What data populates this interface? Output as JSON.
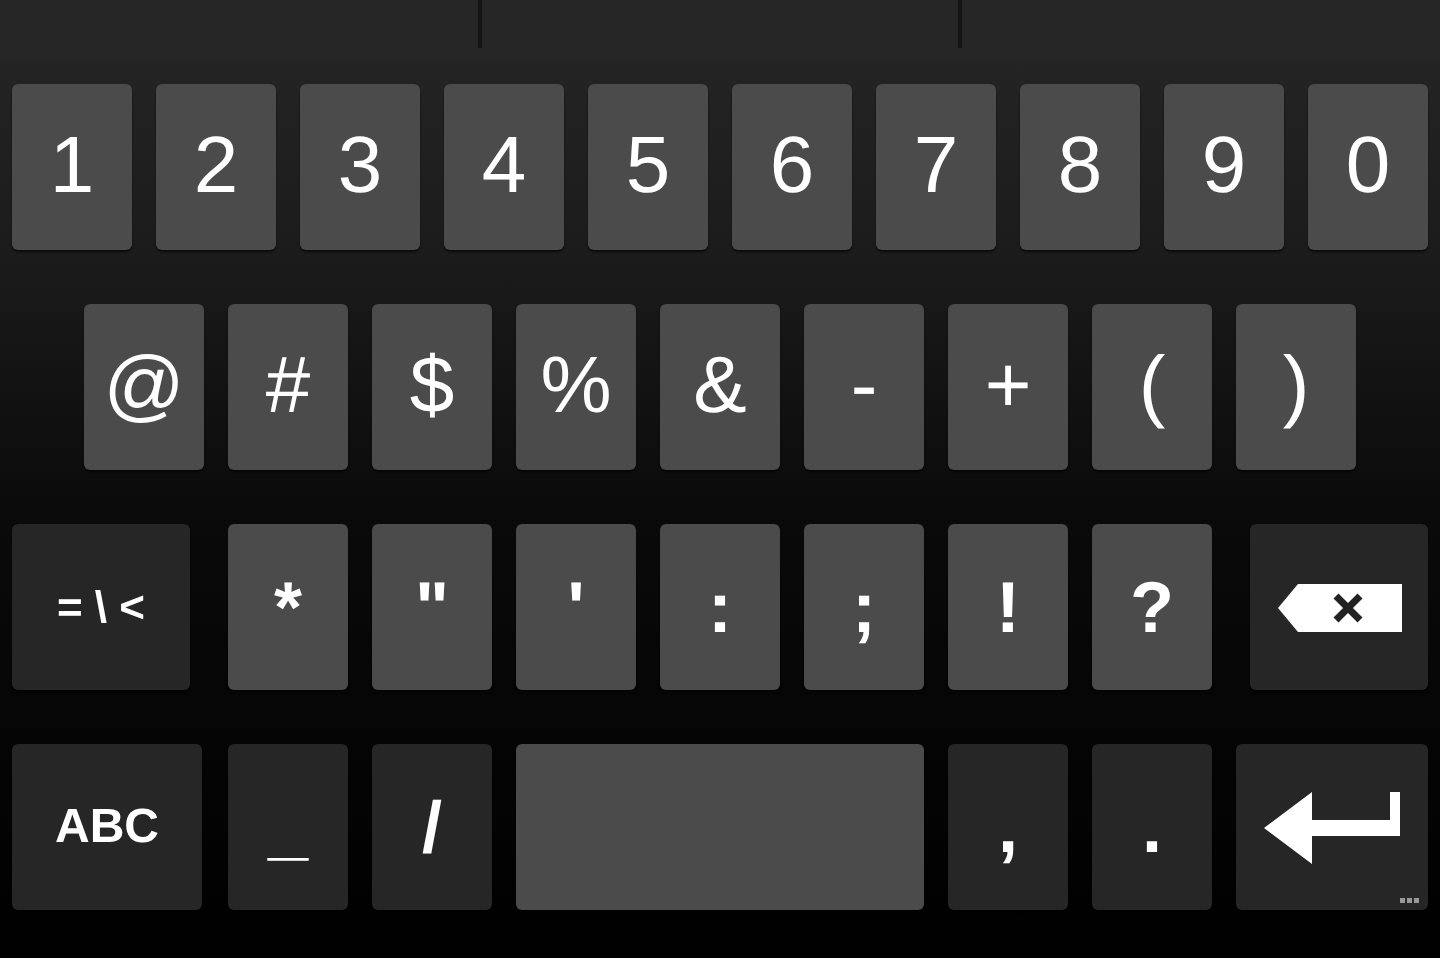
{
  "rows": [
    [
      {
        "kind": "char",
        "label": "1"
      },
      {
        "kind": "char",
        "label": "2"
      },
      {
        "kind": "char",
        "label": "3"
      },
      {
        "kind": "char",
        "label": "4"
      },
      {
        "kind": "char",
        "label": "5"
      },
      {
        "kind": "char",
        "label": "6"
      },
      {
        "kind": "char",
        "label": "7"
      },
      {
        "kind": "char",
        "label": "8"
      },
      {
        "kind": "char",
        "label": "9"
      },
      {
        "kind": "char",
        "label": "0"
      }
    ],
    [
      {
        "kind": "char",
        "label": "@"
      },
      {
        "kind": "char",
        "label": "#"
      },
      {
        "kind": "char",
        "label": "$"
      },
      {
        "kind": "char",
        "label": "%"
      },
      {
        "kind": "char",
        "label": "&"
      },
      {
        "kind": "char",
        "label": "-"
      },
      {
        "kind": "char",
        "label": "+"
      },
      {
        "kind": "char",
        "label": "("
      },
      {
        "kind": "char",
        "label": ")"
      }
    ],
    [
      {
        "kind": "mode",
        "label": "= \\ <"
      },
      {
        "kind": "char",
        "label": "*"
      },
      {
        "kind": "char",
        "label": "\""
      },
      {
        "kind": "char",
        "label": "'"
      },
      {
        "kind": "char",
        "label": ":"
      },
      {
        "kind": "char",
        "label": ";"
      },
      {
        "kind": "char",
        "label": "!"
      },
      {
        "kind": "char",
        "label": "?"
      },
      {
        "kind": "delete"
      }
    ],
    [
      {
        "kind": "mode",
        "label": "ABC"
      },
      {
        "kind": "alt-char",
        "label": "_"
      },
      {
        "kind": "alt-char",
        "label": "/"
      },
      {
        "kind": "space"
      },
      {
        "kind": "alt-char",
        "label": ","
      },
      {
        "kind": "alt-char",
        "label": "."
      },
      {
        "kind": "enter"
      }
    ]
  ]
}
